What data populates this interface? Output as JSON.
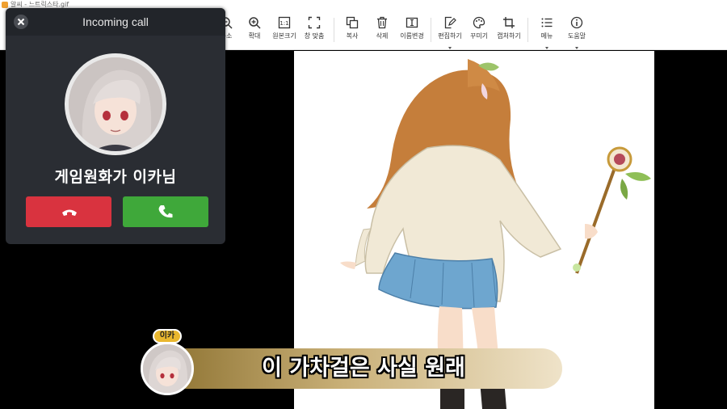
{
  "window": {
    "title": "알씨 - 느트릭스타.gif"
  },
  "toolbar": {
    "tools": [
      {
        "label": "축소",
        "icon": "zoom-out-icon"
      },
      {
        "label": "확대",
        "icon": "zoom-in-icon"
      },
      {
        "label": "원본크기",
        "icon": "actual-size-icon"
      },
      {
        "label": "창 맞춤",
        "icon": "fit-window-icon"
      },
      {
        "label": "복사",
        "icon": "copy-icon"
      },
      {
        "label": "삭제",
        "icon": "trash-icon"
      },
      {
        "label": "이름변경",
        "icon": "rename-icon"
      },
      {
        "label": "편집하기",
        "icon": "edit-icon"
      },
      {
        "label": "꾸미기",
        "icon": "palette-icon"
      },
      {
        "label": "캡처하기",
        "icon": "crop-icon"
      },
      {
        "label": "메뉴",
        "icon": "menu-list-icon"
      },
      {
        "label": "도움말",
        "icon": "info-icon"
      }
    ]
  },
  "call": {
    "title": "Incoming call",
    "caller": "게임원화가 이카님",
    "decline_icon": "phone-hangup-icon",
    "accept_icon": "phone-icon",
    "colors": {
      "decline": "#d9333f",
      "accept": "#3fa83a"
    }
  },
  "subtitle": {
    "speaker": "이카",
    "text": "이 가차걸은 사실 원래"
  }
}
